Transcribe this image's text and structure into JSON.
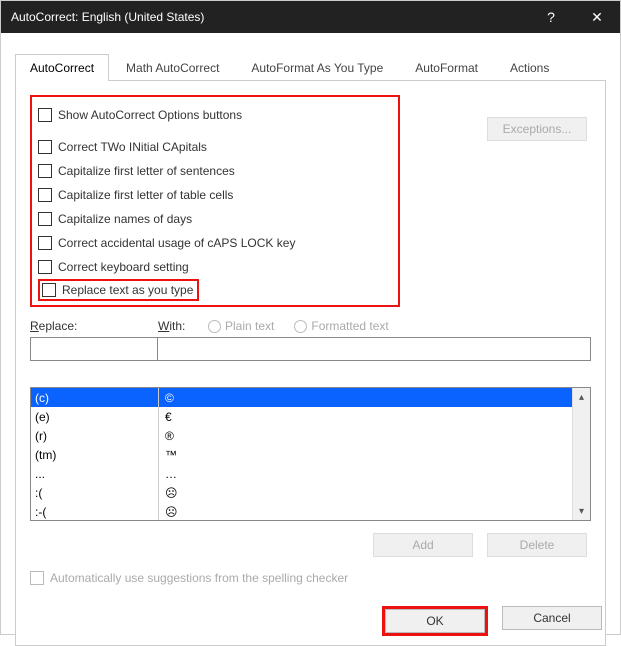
{
  "window": {
    "title": "AutoCorrect: English (United States)",
    "help": "?",
    "close": "✕"
  },
  "tabs": [
    {
      "label": "AutoCorrect",
      "active": true
    },
    {
      "label": "Math AutoCorrect",
      "active": false
    },
    {
      "label": "AutoFormat As You Type",
      "active": false
    },
    {
      "label": "AutoFormat",
      "active": false
    },
    {
      "label": "Actions",
      "active": false
    }
  ],
  "checkboxes": {
    "show_options": "Show AutoCorrect Options buttons",
    "two_initial": "Correct TWo INitial CApitals",
    "first_sentence": "Capitalize first letter of sentences",
    "first_table": "Capitalize first letter of table cells",
    "days": "Capitalize names of days",
    "caps_lock": "Correct accidental usage of cAPS LOCK key",
    "keyboard": "Correct keyboard setting",
    "replace_type": "Replace text as you type"
  },
  "exceptions_label": "Exceptions...",
  "replace_label": "Replace:",
  "with_label": "With:",
  "radio_plain": "Plain text",
  "radio_formatted": "Formatted text",
  "table_rows": [
    {
      "from": "(c)",
      "to": "©",
      "selected": true
    },
    {
      "from": "(e)",
      "to": "€",
      "selected": false
    },
    {
      "from": "(r)",
      "to": "®",
      "selected": false
    },
    {
      "from": "(tm)",
      "to": "™",
      "selected": false
    },
    {
      "from": "...",
      "to": "…",
      "selected": false
    },
    {
      "from": ":(",
      "to": "☹",
      "selected": false
    },
    {
      "from": ":-(",
      "to": "☹",
      "selected": false
    }
  ],
  "buttons": {
    "add": "Add",
    "delete": "Delete",
    "ok": "OK",
    "cancel": "Cancel"
  },
  "auto_suggest": "Automatically use suggestions from the spelling checker"
}
